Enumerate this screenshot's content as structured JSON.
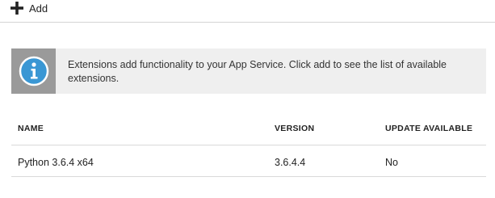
{
  "toolbar": {
    "add_label": "Add"
  },
  "info_banner": {
    "icon": "info-icon",
    "text": "Extensions add functionality to your App Service. Click add to see the list of available extensions."
  },
  "extensions_table": {
    "columns": [
      "NAME",
      "VERSION",
      "UPDATE AVAILABLE"
    ],
    "rows": [
      {
        "name": "Python 3.6.4 x64",
        "version": "3.6.4.4",
        "update_available": "No"
      }
    ]
  },
  "colors": {
    "info_icon_bg": "#9a9a9a",
    "info_icon_circle": "#3a97d4",
    "banner_bg": "#efefef"
  }
}
